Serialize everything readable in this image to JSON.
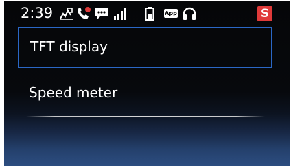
{
  "status_bar": {
    "time": "2:39",
    "icons": [
      "car-route-icon",
      "phone-missed-call-icon",
      "message-icon",
      "signal-bars-icon",
      "battery-icon",
      "app-icon",
      "headset-icon"
    ],
    "app_label": "App",
    "badge_label": "S",
    "badge_color": "#e03a3a"
  },
  "menu": {
    "items": [
      {
        "label": "TFT display",
        "selected": true
      },
      {
        "label": "Speed meter",
        "selected": false
      }
    ],
    "highlight_color": "#2a67c6"
  }
}
